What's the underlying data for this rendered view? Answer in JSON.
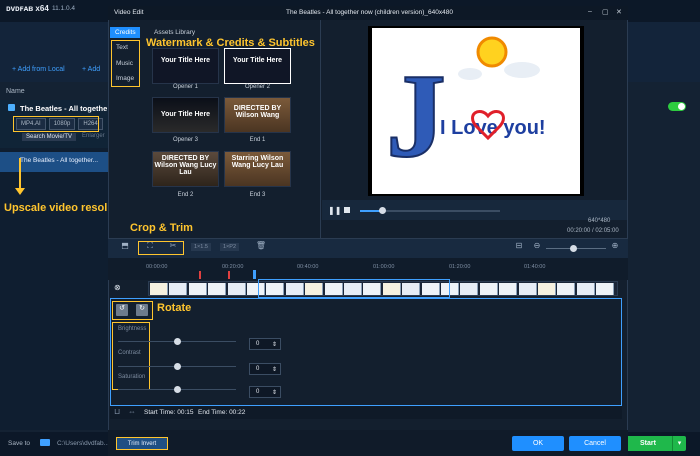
{
  "app": {
    "logo": "ᴅᴠᴅꜰᴀʙ x64",
    "version": "11.1.0.4",
    "add_from_local": "+ Add from Local",
    "add_more": "+ Add",
    "list_header": "Name",
    "item_title": "The Beatles - All togethe",
    "badges": [
      "MP4.AI",
      "1080p",
      "H264"
    ],
    "search_movie": "Search Movie/TV",
    "enlarge": "Enlarger",
    "selected_row": "The Beatles - All together...",
    "annotation_upscale": "Upscale video resolution",
    "save_to_label": "Save to",
    "save_to_path": "C:\\Users\\dvdfab...",
    "start_label": "Start",
    "start_caret": "▾"
  },
  "modal": {
    "title": "Video Edit",
    "file_title": "The Beatles - All together now (children version)_640x480",
    "controls": [
      "–",
      "▢",
      "✕"
    ],
    "nav": {
      "active": "Credits",
      "items": [
        "Text",
        "Music",
        "Image"
      ]
    },
    "assets_label": "Assets Library",
    "annotation_watermark": "Watermark & Credits & Subtitles",
    "thumbnails": [
      {
        "text": "Your Title Here",
        "caption": "Opener 1",
        "selected": false
      },
      {
        "text": "Your Title Here",
        "caption": "Opener 2",
        "selected": true
      },
      {
        "text": "Your Title Here",
        "caption": "Opener 3",
        "selected": false
      },
      {
        "text": "DIRECTED BY Wilson Wang",
        "caption": "End 1",
        "selected": false
      },
      {
        "text": "DIRECTED BY Wilson Wang Lucy Lau",
        "caption": "End 2",
        "selected": false
      },
      {
        "text": "Starring Wilson Wang Lucy Lau",
        "caption": "End 3",
        "selected": false
      }
    ],
    "preview": {
      "letter": "J",
      "text": "I Love you!",
      "resolution": "640*480",
      "time": "00:20:00 / 02:05:00"
    },
    "annotation_crop": "Crop & Trim",
    "timeline_chips": [
      "1×1.5",
      "1×P2"
    ],
    "ruler": [
      "00:00:00",
      "00:20:00",
      "00:40:00",
      "01:00:00",
      "01:20:00",
      "01:40:00"
    ],
    "annotation_rotate": "Rotate",
    "sliders": [
      {
        "label": "Brightness",
        "value": "0",
        "level": 0.5
      },
      {
        "label": "Contrast",
        "value": "0",
        "level": 0.5
      },
      {
        "label": "Saturation",
        "value": "0",
        "level": 0.5
      }
    ],
    "start_time": "Start Time: 00:15",
    "end_time": "End Time: 00:22",
    "trim_invert": "Trim Invert",
    "ok": "OK",
    "cancel": "Cancel"
  },
  "colors": {
    "accent": "#1f8fff",
    "annotation": "#ffc52e",
    "start": "#1fb84b"
  }
}
